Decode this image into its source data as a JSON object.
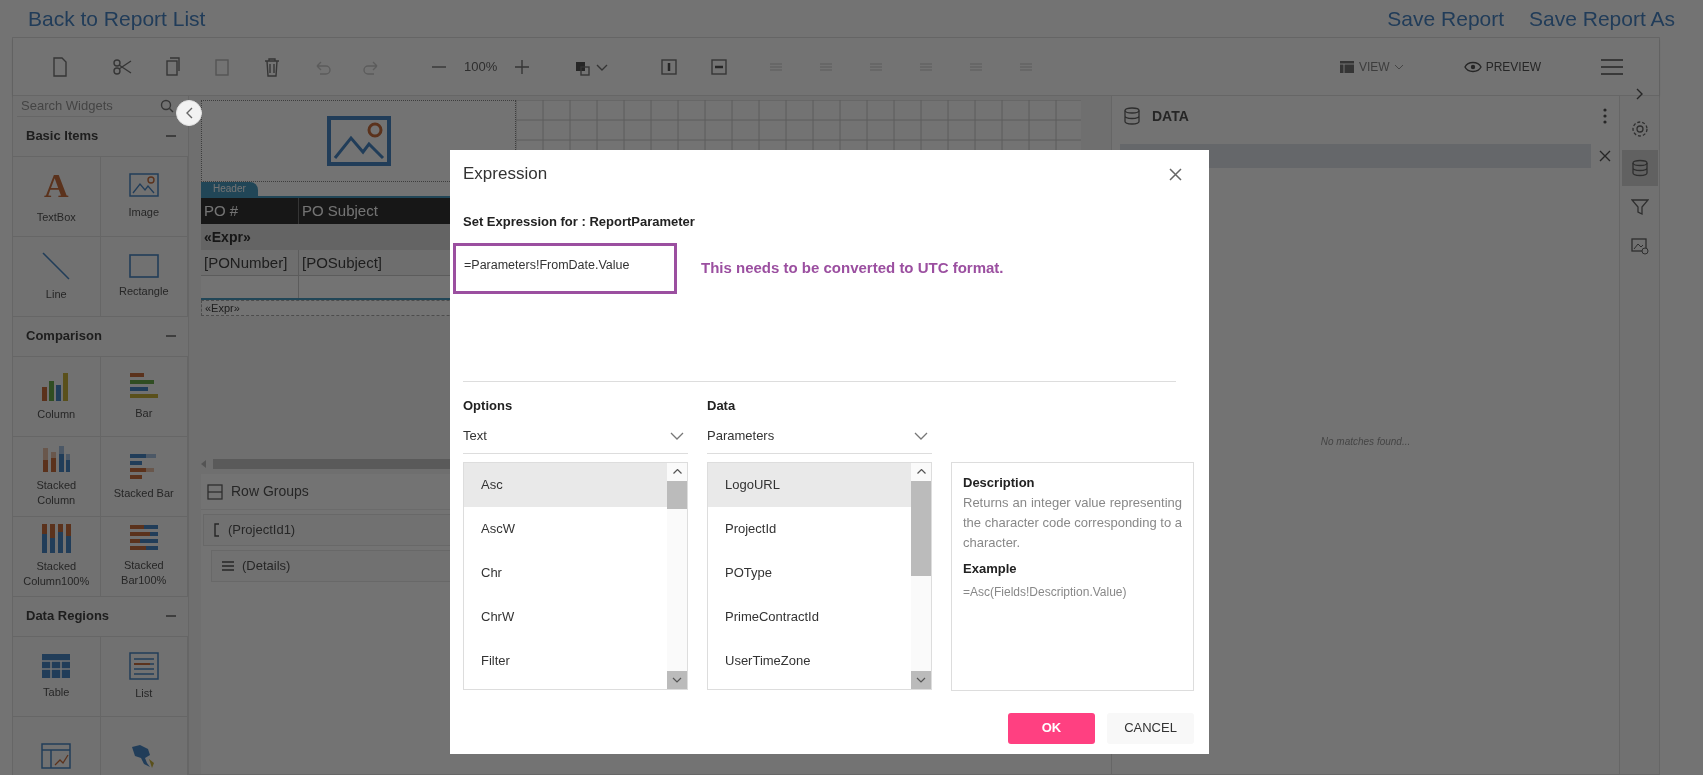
{
  "header": {
    "back_link": "Back to Report List",
    "actions": [
      "Save Report",
      "Save Report As"
    ]
  },
  "toolbar": {
    "zoom": "100%",
    "view": "VIEW",
    "preview": "PREVIEW"
  },
  "sidebar": {
    "search": {
      "placeholder": "Search Widgets"
    },
    "sections": [
      {
        "title": "Basic Items",
        "items": [
          {
            "label": "TextBox",
            "kind": "textbox",
            "glyph": "A"
          },
          {
            "label": "Image",
            "kind": "image"
          },
          {
            "label": "Line",
            "kind": "line"
          },
          {
            "label": "Rectangle",
            "kind": "rectangle"
          }
        ]
      },
      {
        "title": "Comparison",
        "items": [
          {
            "label": "Column",
            "kind": "column"
          },
          {
            "label": "Bar",
            "kind": "bar"
          },
          {
            "label": "Stacked Column",
            "kind": "stacked-column"
          },
          {
            "label": "Stacked Bar",
            "kind": "stacked-bar"
          },
          {
            "label": "Stacked Column100%",
            "kind": "stacked-column-100"
          },
          {
            "label": "Stacked Bar100%",
            "kind": "stacked-bar-100"
          }
        ]
      },
      {
        "title": "Data Regions",
        "items": [
          {
            "label": "Table",
            "kind": "table"
          },
          {
            "label": "List",
            "kind": "list"
          },
          {
            "kind": "matrix"
          },
          {
            "kind": "map"
          }
        ]
      }
    ]
  },
  "canvas": {
    "header_tab": "Header",
    "table": {
      "columns": [
        "PO #",
        "PO Subject"
      ],
      "group_row": "«Expr»",
      "detail_row": [
        "[PONumber]",
        "[POSubject]"
      ]
    },
    "footer": "«Expr»"
  },
  "row_groups": {
    "title": "Row Groups",
    "items": [
      {
        "label": "(ProjectId1)",
        "kind": "group"
      },
      {
        "label": "(Details)",
        "kind": "details"
      }
    ]
  },
  "data_panel": {
    "title": "DATA",
    "empty_message": "No matches found..."
  },
  "right_rail": [
    {
      "kind": "settings",
      "selected": false
    },
    {
      "kind": "data",
      "selected": true
    },
    {
      "kind": "filter",
      "selected": false
    },
    {
      "kind": "image",
      "selected": false
    }
  ],
  "dialog": {
    "title": "Expression",
    "subtitle": "Set Expression for : ReportParameter",
    "expression": "=Parameters!FromDate.Value",
    "annotation": "This needs to be converted to UTC format.",
    "options": {
      "label": "Options",
      "value": "Text",
      "items": [
        {
          "label": "Asc",
          "selected": true
        },
        {
          "label": "AscW",
          "selected": false
        },
        {
          "label": "Chr",
          "selected": false
        },
        {
          "label": "ChrW",
          "selected": false
        },
        {
          "label": "Filter",
          "selected": false
        }
      ]
    },
    "data": {
      "label": "Data",
      "value": "Parameters",
      "items": [
        {
          "label": "LogoURL",
          "selected": true
        },
        {
          "label": "ProjectId",
          "selected": false
        },
        {
          "label": "POType",
          "selected": false
        },
        {
          "label": "PrimeContractId",
          "selected": false
        },
        {
          "label": "UserTimeZone",
          "selected": false
        }
      ]
    },
    "description": {
      "title": "Description",
      "text": "Returns an integer value representing the character code corresponding to a character.",
      "example_title": "Example",
      "example": "=Asc(Fields!Description.Value)"
    },
    "buttons": [
      {
        "label": "OK",
        "kind": "primary"
      },
      {
        "label": "CANCEL",
        "kind": "secondary"
      }
    ]
  }
}
